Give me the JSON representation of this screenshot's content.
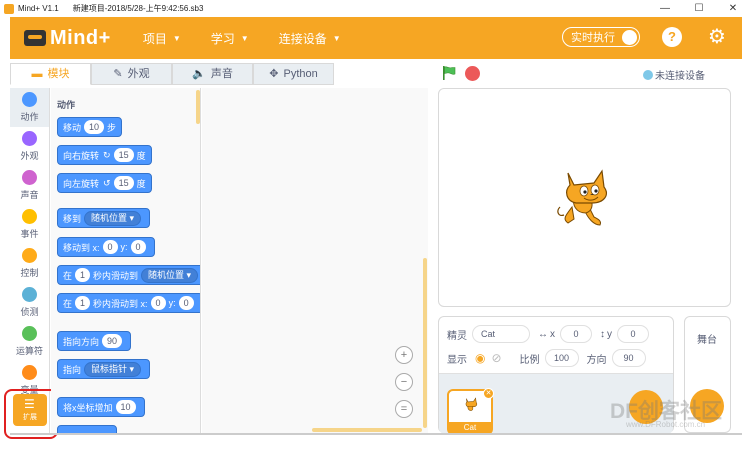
{
  "window": {
    "app_name": "Mind+ V1.1",
    "file": "新建项目-2018/5/28-上午9:42:56.sb3",
    "min": "—",
    "max": "☐",
    "close": "✕"
  },
  "menubar": {
    "logo": "Mind+",
    "items": [
      "项目",
      "学习",
      "连接设备"
    ],
    "realtime_label": "实时执行",
    "help": "?",
    "settings": "⚙"
  },
  "tabs": [
    {
      "icon": "▬",
      "label": "模块"
    },
    {
      "icon": "✎",
      "label": "外观"
    },
    {
      "icon": "🔈",
      "label": "声音"
    },
    {
      "icon": "✥",
      "label": "Python"
    }
  ],
  "device_status": "未连接设备",
  "categories": [
    {
      "label": "动作",
      "color": "#4c97ff"
    },
    {
      "label": "外观",
      "color": "#9966ff"
    },
    {
      "label": "声音",
      "color": "#cf63cf"
    },
    {
      "label": "事件",
      "color": "#ffbf00"
    },
    {
      "label": "控制",
      "color": "#ffab19"
    },
    {
      "label": "侦测",
      "color": "#5cb1d6"
    },
    {
      "label": "运算符",
      "color": "#59c059"
    },
    {
      "label": "变量",
      "color": "#ff8c1a"
    }
  ],
  "extension_label": "扩展",
  "palette": {
    "heading": "动作",
    "blocks": {
      "move": {
        "pre": "移动",
        "v": "10",
        "post": "步"
      },
      "turn_right": {
        "pre": "向右旋转",
        "icon": "↻",
        "v": "15",
        "post": "度"
      },
      "turn_left": {
        "pre": "向左旋转",
        "icon": "↺",
        "v": "15",
        "post": "度"
      },
      "goto": {
        "pre": "移到",
        "dd": "随机位置 ▾"
      },
      "goto_xy": {
        "pre": "移动到 x:",
        "x": "0",
        "mid": "y:",
        "y": "0"
      },
      "glide": {
        "pre": "在",
        "v": "1",
        "mid": "秒内滑动到",
        "dd": "随机位置 ▾"
      },
      "glide_xy": {
        "pre": "在",
        "v": "1",
        "mid": "秒内滑动到 x:",
        "x": "0",
        "mid2": "y:",
        "y": "0"
      },
      "point_dir": {
        "pre": "指向方向",
        "v": "90"
      },
      "point_to": {
        "pre": "指向",
        "dd": "鼠标指针 ▾"
      },
      "change_x": {
        "pre": "将x坐标增加",
        "v": "10"
      }
    }
  },
  "zoom": {
    "in": "+",
    "out": "−",
    "reset": "="
  },
  "sprite_info": {
    "sprite_label": "精灵",
    "sprite_name": "Cat",
    "x_label": "x",
    "x_value": "0",
    "y_label": "y",
    "y_value": "0",
    "show_label": "显示",
    "size_label": "比例",
    "size_value": "100",
    "direction_label": "方向",
    "direction_value": "90"
  },
  "sprite_list": [
    {
      "name": "Cat"
    }
  ],
  "stage_label": "舞台",
  "watermark": "DF创客社区",
  "watermark_sub": "www.DFRobot.com.cn"
}
